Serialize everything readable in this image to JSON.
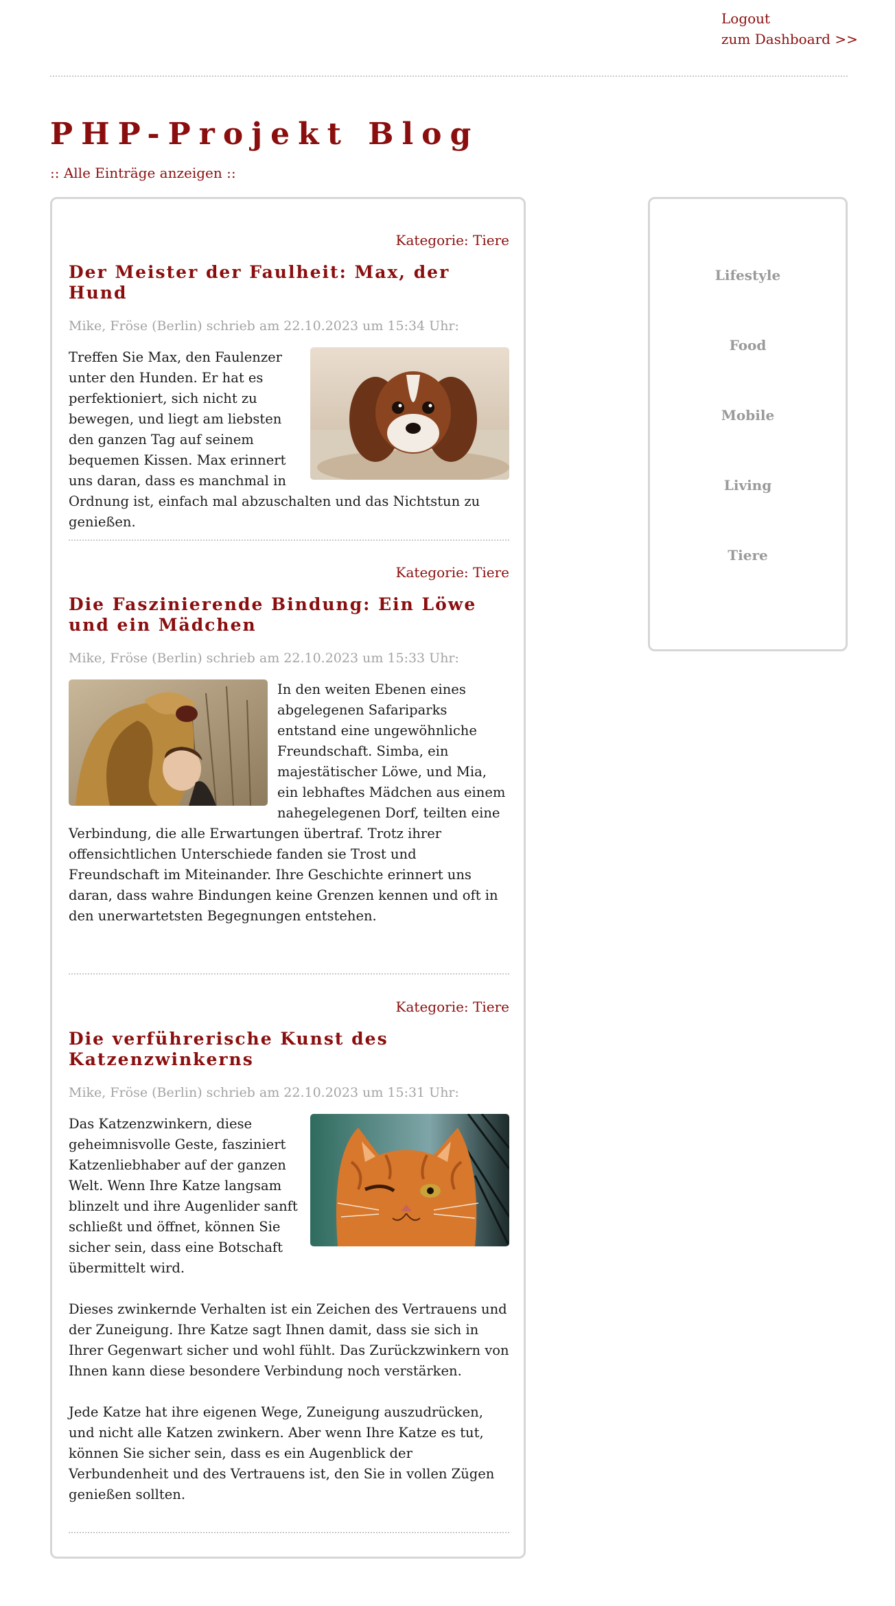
{
  "header": {
    "logout_label": "Logout",
    "dashboard_label": "zum Dashboard >>"
  },
  "site": {
    "title": "PHP-Projekt Blog",
    "show_all_label": ":: Alle Einträge anzeigen ::"
  },
  "colors": {
    "accent": "#8b0e0e",
    "muted": "#9a9a9a",
    "border": "#d6d6d6"
  },
  "posts": [
    {
      "category": "Kategorie: Tiere",
      "title": "Der Meister der Faulheit: Max, der Hund",
      "meta": "Mike, Fröse (Berlin) schrieb am 22.10.2023 um 15:34 Uhr:",
      "image": "dog-photo",
      "image_position": "right",
      "paragraphs": [
        "Treffen Sie Max, den Faulenzer unter den Hunden. Er hat es perfektioniert, sich nicht zu bewegen, und liegt am liebsten den ganzen Tag auf seinem bequemen Kissen. Max erinnert uns daran, dass es manchmal in Ordnung ist, einfach mal abzuschalten und das Nichtstun zu genießen."
      ]
    },
    {
      "category": "Kategorie: Tiere",
      "title": "Die Faszinierende Bindung: Ein Löwe und ein Mädchen",
      "meta": "Mike, Fröse (Berlin) schrieb am 22.10.2023 um 15:33 Uhr:",
      "image": "lion-girl-photo",
      "image_position": "left",
      "paragraphs": [
        "In den weiten Ebenen eines abgelegenen Safariparks entstand eine ungewöhnliche Freundschaft. Simba, ein majestätischer Löwe, und Mia, ein lebhaftes Mädchen aus einem nahegelegenen Dorf, teilten eine Verbindung, die alle Erwartungen übertraf. Trotz ihrer offensichtlichen Unterschiede fanden sie Trost und Freundschaft im Miteinander. Ihre Geschichte erinnert uns daran, dass wahre Bindungen keine Grenzen kennen und oft in den unerwartetsten Begegnungen entstehen."
      ]
    },
    {
      "category": "Kategorie: Tiere",
      "title": "Die verführerische Kunst des Katzenzwinkerns",
      "meta": "Mike, Fröse (Berlin) schrieb am 22.10.2023 um 15:31 Uhr:",
      "image": "cat-photo",
      "image_position": "right",
      "paragraphs": [
        "Das Katzenzwinkern, diese geheimnisvolle Geste, fasziniert Katzenliebhaber auf der ganzen Welt. Wenn Ihre Katze langsam blinzelt und ihre Augenlider sanft schließt und öffnet, können Sie sicher sein, dass eine Botschaft übermittelt wird.",
        "Dieses zwinkernde Verhalten ist ein Zeichen des Vertrauens und der Zuneigung. Ihre Katze sagt Ihnen damit, dass sie sich in Ihrer Gegenwart sicher und wohl fühlt. Das Zurückzwinkern von Ihnen kann diese besondere Verbindung noch verstärken.",
        "Jede Katze hat ihre eigenen Wege, Zuneigung auszudrücken, und nicht alle Katzen zwinkern. Aber wenn Ihre Katze es tut, können Sie sicher sein, dass es ein Augenblick der Verbundenheit und des Vertrauens ist, den Sie in vollen Zügen genießen sollten."
      ]
    }
  ],
  "sidebar": {
    "categories": [
      "Lifestyle",
      "Food",
      "Mobile",
      "Living",
      "Tiere"
    ]
  }
}
